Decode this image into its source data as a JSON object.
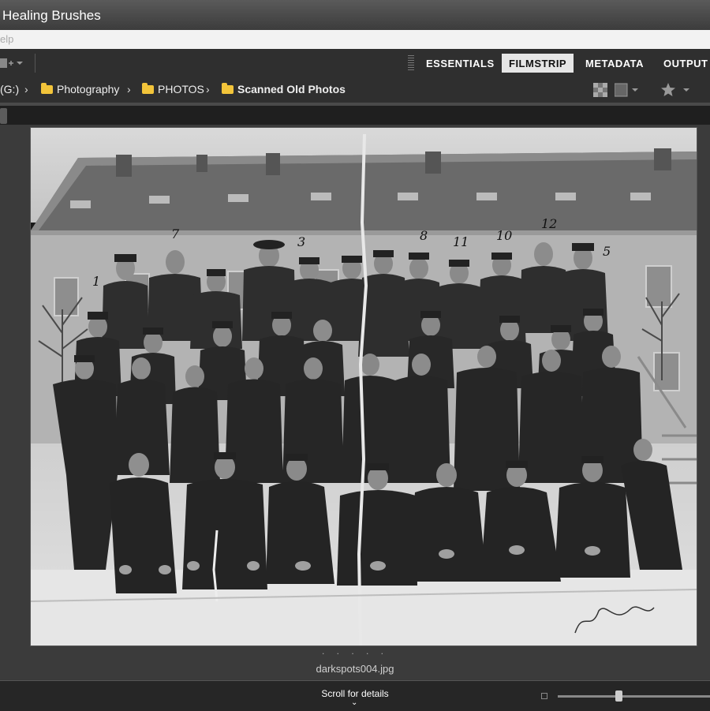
{
  "window": {
    "title": "Healing Brushes"
  },
  "menubar": {
    "partial_item": "elp"
  },
  "workspaces": [
    {
      "label": "ESSENTIALS",
      "active": false
    },
    {
      "label": "FILMSTRIP",
      "active": true
    },
    {
      "label": "METADATA",
      "active": false
    },
    {
      "label": "OUTPUT",
      "active": false
    }
  ],
  "breadcrumb": {
    "drive": "(G:)",
    "items": [
      "Photography",
      "PHOTOS",
      "Scanned Old Photos"
    ]
  },
  "preview": {
    "dots": ". . . . .",
    "filename": "darkspots004.jpg"
  },
  "footer": {
    "scroll_label": "Scroll for details",
    "zoom_slider": 0.4
  },
  "colors": {
    "active_tab_bg": "#e6e6e6",
    "folder_icon": "#f2c43a"
  }
}
